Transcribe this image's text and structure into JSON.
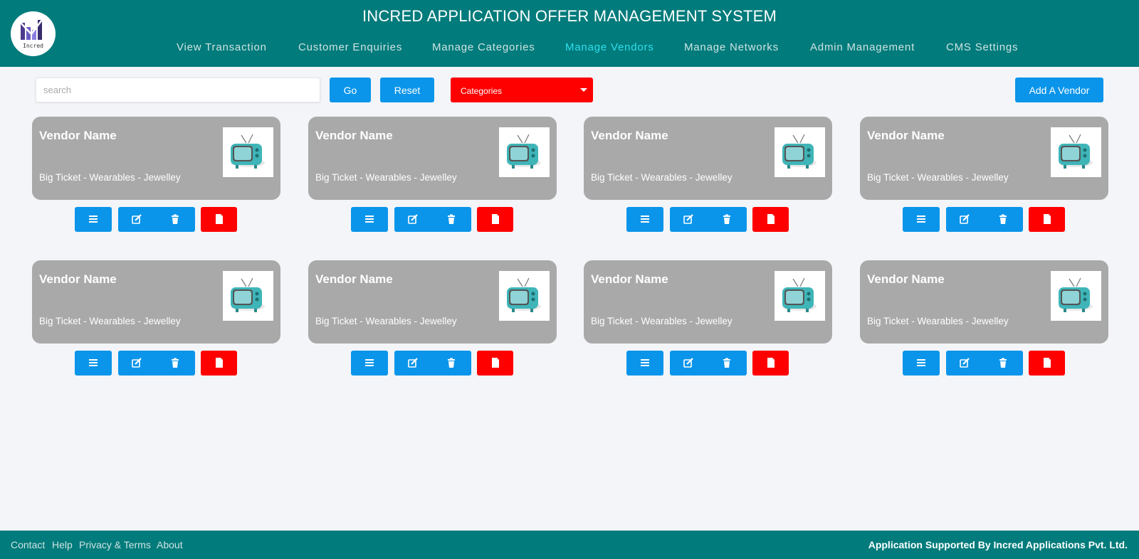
{
  "header": {
    "title": "INCRED APPLICATION OFFER MANAGEMENT SYSTEM",
    "logo_text": "Incred",
    "nav": [
      {
        "label": "View Transaction",
        "active": false
      },
      {
        "label": "Customer Enquiries",
        "active": false
      },
      {
        "label": "Manage Categories",
        "active": false
      },
      {
        "label": "Manage Vendors",
        "active": true
      },
      {
        "label": "Manage Networks",
        "active": false
      },
      {
        "label": "Admin Management",
        "active": false
      },
      {
        "label": "CMS Settings",
        "active": false
      }
    ]
  },
  "toolbar": {
    "search_placeholder": "search",
    "search_value": "",
    "go_label": "Go",
    "reset_label": "Reset",
    "categories_label": "Categories",
    "add_vendor_label": "Add A Vendor"
  },
  "vendors": [
    {
      "name": "Vendor Name",
      "categories": "Big Ticket - Wearables - Jewelley",
      "thumbnail_icon": "tv-icon"
    },
    {
      "name": "Vendor Name",
      "categories": "Big Ticket - Wearables - Jewelley",
      "thumbnail_icon": "tv-icon"
    },
    {
      "name": "Vendor Name",
      "categories": "Big Ticket - Wearables - Jewelley",
      "thumbnail_icon": "tv-icon"
    },
    {
      "name": "Vendor Name",
      "categories": "Big Ticket - Wearables - Jewelley",
      "thumbnail_icon": "tv-icon"
    },
    {
      "name": "Vendor Name",
      "categories": "Big Ticket - Wearables - Jewelley",
      "thumbnail_icon": "tv-icon"
    },
    {
      "name": "Vendor Name",
      "categories": "Big Ticket - Wearables - Jewelley",
      "thumbnail_icon": "tv-icon"
    },
    {
      "name": "Vendor Name",
      "categories": "Big Ticket - Wearables - Jewelley",
      "thumbnail_icon": "tv-icon"
    },
    {
      "name": "Vendor Name",
      "categories": "Big Ticket - Wearables - Jewelley",
      "thumbnail_icon": "tv-icon"
    }
  ],
  "card_actions": [
    "menu-icon",
    "edit-icon",
    "trash-icon",
    "document-icon"
  ],
  "footer": {
    "links": [
      "Contact",
      "Help",
      "Privacy & Terms",
      "About"
    ],
    "right_text": "Application Supported By Incred Applications Pvt. Ltd."
  },
  "colors": {
    "header_bg": "#017b7b",
    "accent_blue": "#0a95ea",
    "accent_red": "#ff0000",
    "active_nav": "#2fe0f0",
    "card_bg": "#a9a9a9",
    "page_bg": "#f4f5f9"
  }
}
